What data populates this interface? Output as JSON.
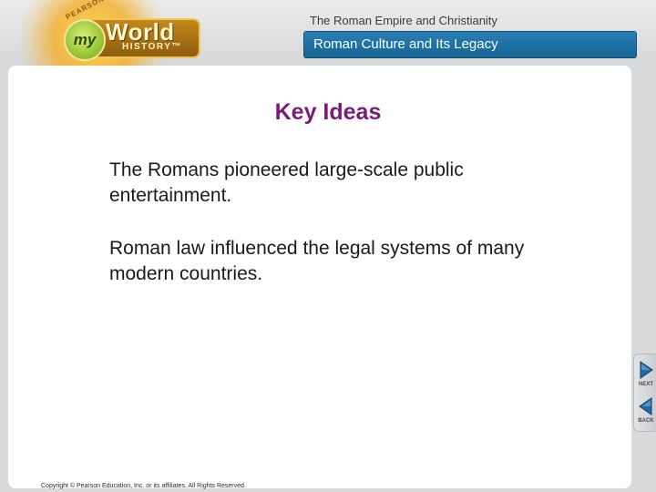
{
  "header": {
    "logo": {
      "publisher": "PEARSON",
      "my": "my",
      "world": "World",
      "history": "HISTORY™"
    },
    "chapter_title": "The Roman Empire and Christianity",
    "section_title": "Roman Culture and Its Legacy"
  },
  "slide": {
    "heading": "Key Ideas",
    "ideas": [
      "The Romans pioneered large-scale public entertainment.",
      "Roman law influenced the legal systems of many modern countries."
    ]
  },
  "footer": {
    "copyright": "Copyright © Pearson Education, Inc. or its affiliates. All Rights Reserved."
  },
  "nav": {
    "next_label": "NEXT",
    "back_label": "BACK"
  },
  "colors": {
    "heading": "#7a1a7a",
    "section_bar": "#1f72a6",
    "nav_arrow": "#1f6aa3"
  }
}
